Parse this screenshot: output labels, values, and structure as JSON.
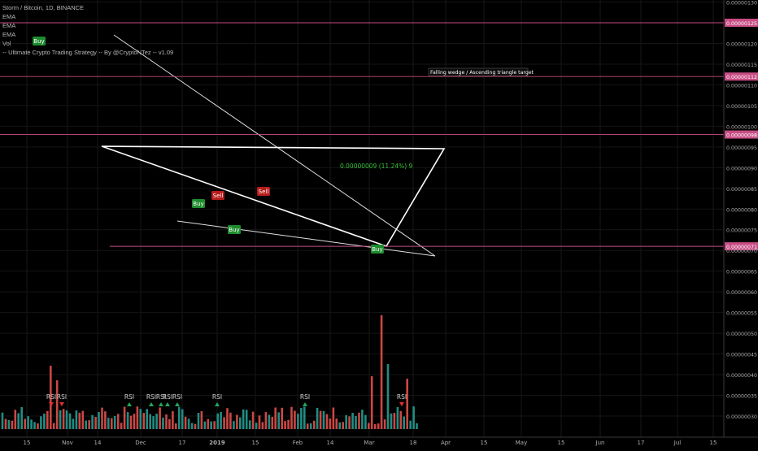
{
  "chart_data": {
    "type": "candlestick",
    "title": "Storm / Bitcoin, 1D, BINANCE",
    "indicators": [
      "EMA",
      "EMA",
      "EMA",
      "Vol",
      "-- Ultimate Crypto Trading Strategy -- By @CryptoNTez -- v1.09"
    ],
    "y_axis": {
      "ticks": [
        "0.00000130",
        "0.00000125",
        "0.00000120",
        "0.00000115",
        "0.00000112",
        "0.00000110",
        "0.00000105",
        "0.00000100",
        "0.00000098",
        "0.00000095",
        "0.00000090",
        "0.00000085",
        "0.00000080",
        "0.00000075",
        "0.00000071",
        "0.00000070",
        "0.00000065",
        "0.00000060",
        "0.00000055",
        "0.00000050",
        "0.00000045",
        "0.00000040",
        "0.00000035",
        "0.00000030"
      ],
      "highlighted": [
        "0.00000125",
        "0.00000112",
        "0.00000098",
        "0.00000071"
      ],
      "range": [
        "0.00000028",
        "0.00000131"
      ]
    },
    "x_axis": {
      "ticks": [
        "15",
        "Nov",
        "14",
        "Dec",
        "17",
        "2019",
        "15",
        "Feb",
        "14",
        "Mar",
        "18",
        "Apr",
        "15",
        "May",
        "15",
        "Jun",
        "17",
        "Jul",
        "15"
      ],
      "bold": [
        "2019"
      ]
    },
    "horizontal_levels": [
      "0.00000125",
      "0.00000112",
      "0.00000098",
      "0.00000071"
    ],
    "annotations": {
      "target": "Falling wedge / Ascending triangle target",
      "measure": "0.00000009 (11.24%) 9"
    },
    "signals": [
      {
        "label": "Buy",
        "kind": "buy"
      },
      {
        "label": "Buy",
        "kind": "buy"
      },
      {
        "label": "Sell",
        "kind": "sell"
      },
      {
        "label": "Sell",
        "kind": "sell"
      },
      {
        "label": "Buy",
        "kind": "buy"
      },
      {
        "label": "Buy",
        "kind": "buy"
      }
    ],
    "rsi_marks": [
      "RSI",
      "RSI",
      "RSI",
      "RSI",
      "RSI",
      "RSI",
      "RSI",
      "RSI",
      "RSI",
      "RSI"
    ],
    "colors": {
      "up": "#26a69a",
      "down": "#ef5350",
      "ema_fast": "#33cc33",
      "ema_slow": "#d93030",
      "cloud": "#3a77c0",
      "level": "#c84d84",
      "buy": "#1e8c2e",
      "sell": "#b71c1c",
      "measure": "#4a74d8"
    }
  }
}
